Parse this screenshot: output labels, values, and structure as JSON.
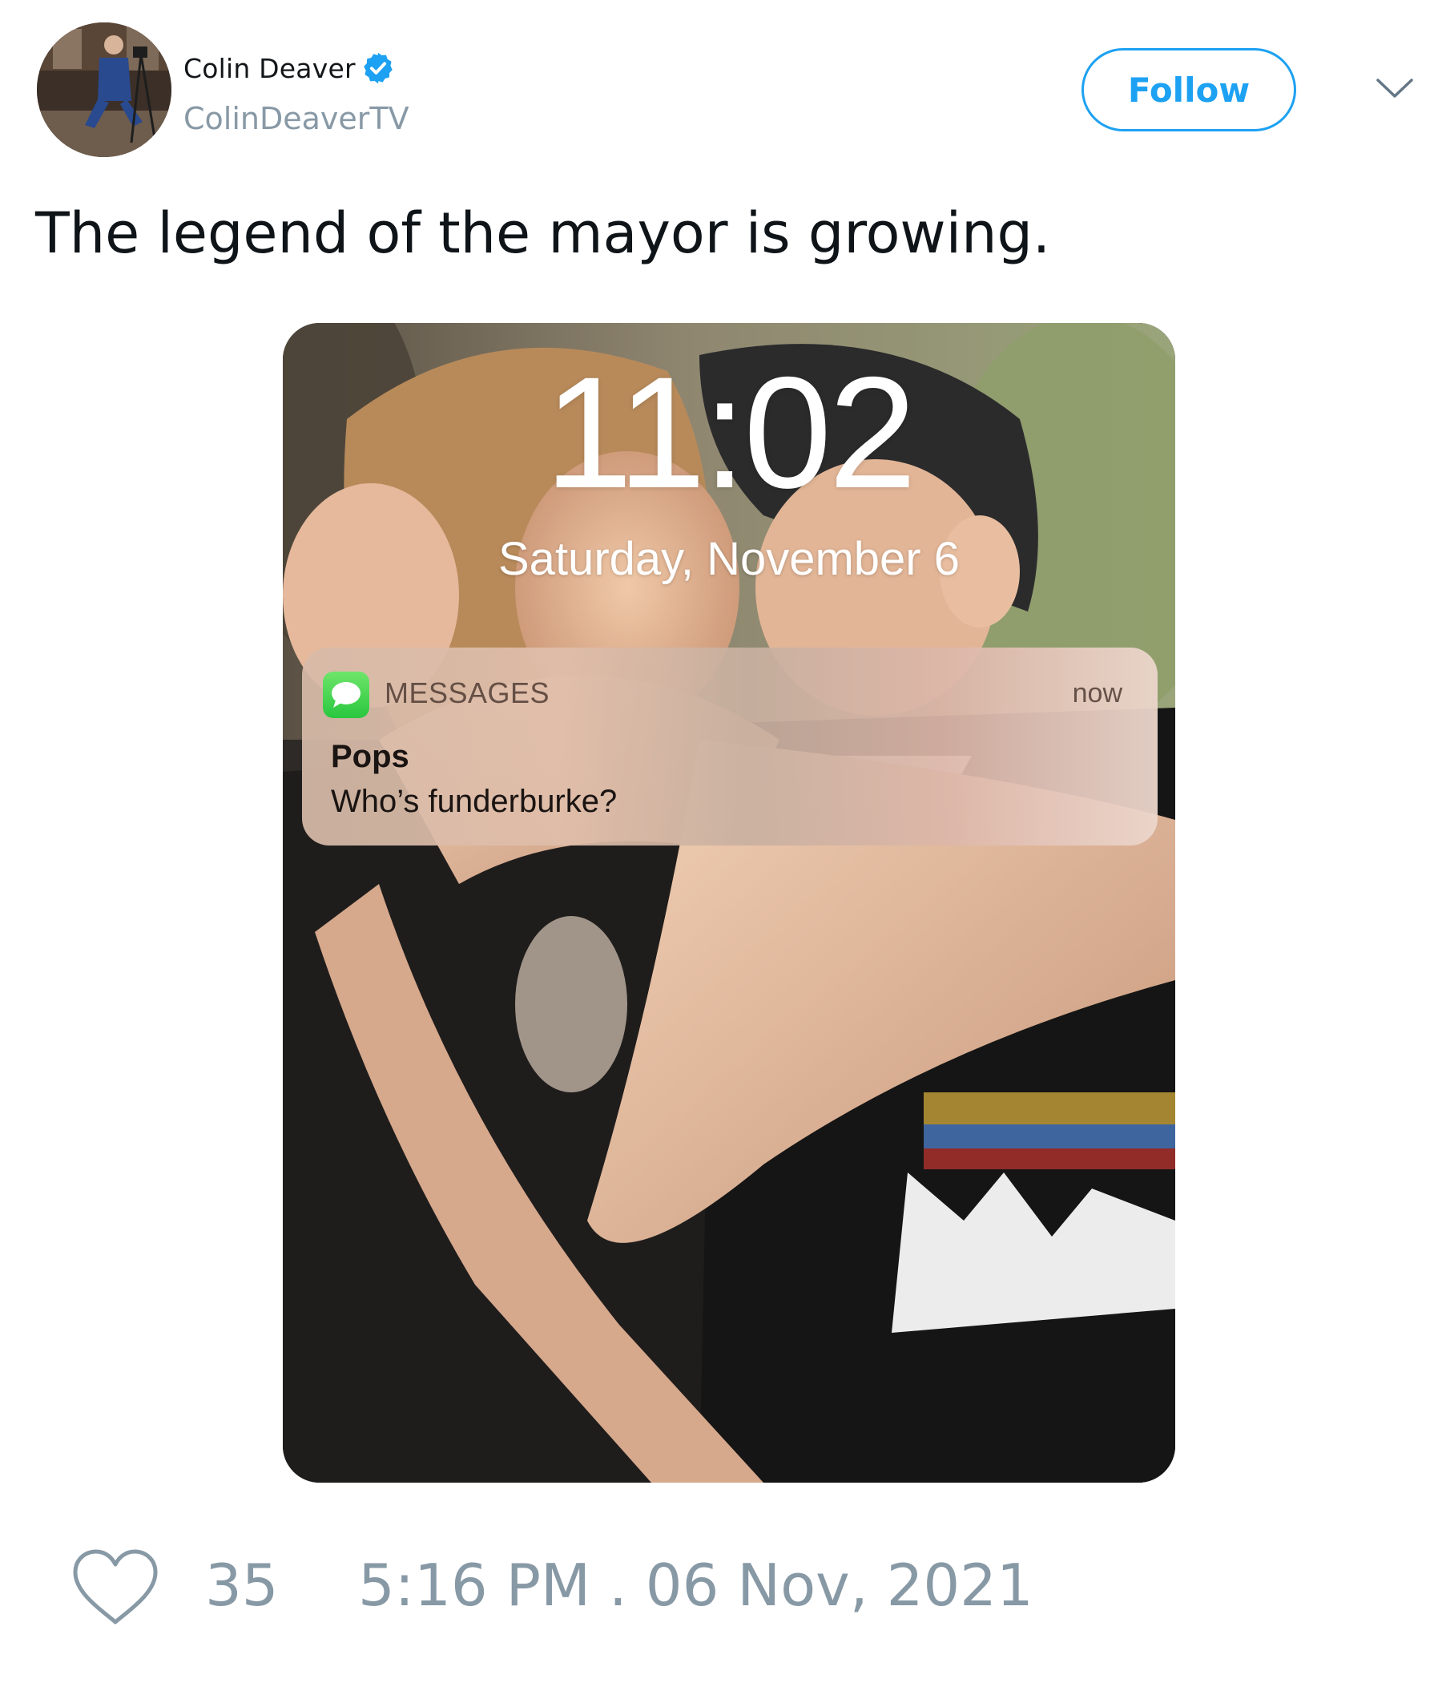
{
  "author": {
    "display_name": "Colin Deaver",
    "handle": "ColinDeaverTV",
    "verified": true,
    "avatar_icon": "avatar-photo"
  },
  "actions": {
    "follow_label": "Follow",
    "menu_icon": "chevron-down-icon"
  },
  "tweet": {
    "text": "The legend of the mayor is growing."
  },
  "media": {
    "lock_screen": {
      "time": "11:02",
      "date": "Saturday, November 6"
    },
    "notification": {
      "app_name": "MESSAGES",
      "time": "now",
      "sender": "Pops",
      "message": "Who’s funderburke?",
      "app_icon": "messages-app-icon"
    }
  },
  "footer": {
    "like_icon": "heart-icon",
    "like_count": "35",
    "timestamp": "5:16 PM . 06 Nov, 2021"
  },
  "colors": {
    "accent": "#1da1f2",
    "secondary_text": "#8899a6",
    "primary_text": "#0f1419"
  }
}
